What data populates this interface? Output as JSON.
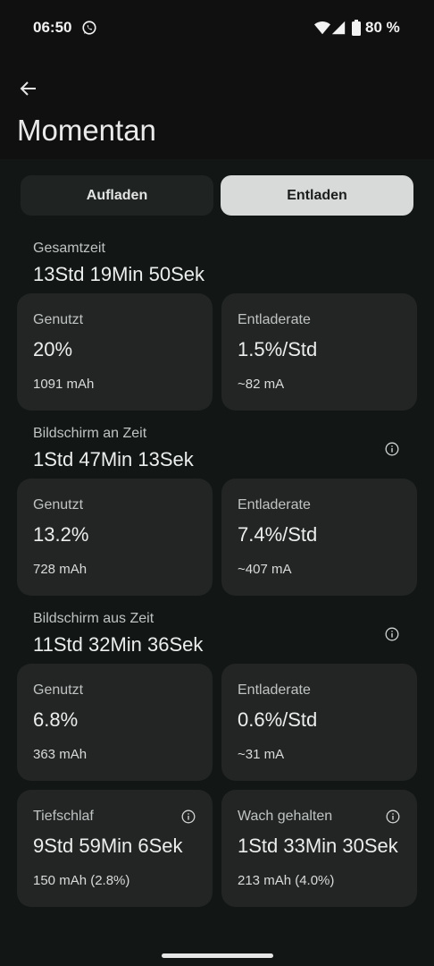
{
  "status": {
    "time": "06:50",
    "battery": "80 %"
  },
  "header": {
    "title": "Momentan"
  },
  "tabs": {
    "charge": "Aufladen",
    "discharge": "Entladen"
  },
  "total": {
    "label": "Gesamtzeit",
    "value": "13Std 19Min 50Sek",
    "used": {
      "label": "Genutzt",
      "value": "20%",
      "sub": "1091 mAh"
    },
    "rate": {
      "label": "Entladerate",
      "value": "1.5%/Std",
      "sub": "~82 mA"
    }
  },
  "screen_on": {
    "label": "Bildschirm an Zeit",
    "value": "1Std 47Min 13Sek",
    "used": {
      "label": "Genutzt",
      "value": "13.2%",
      "sub": "728 mAh"
    },
    "rate": {
      "label": "Entladerate",
      "value": "7.4%/Std",
      "sub": "~407 mA"
    }
  },
  "screen_off": {
    "label": "Bildschirm aus Zeit",
    "value": "11Std 32Min 36Sek",
    "used": {
      "label": "Genutzt",
      "value": "6.8%",
      "sub": "363 mAh"
    },
    "rate": {
      "label": "Entladerate",
      "value": "0.6%/Std",
      "sub": "~31 mA"
    }
  },
  "deep_sleep": {
    "label": "Tiefschlaf",
    "value": "9Std 59Min 6Sek",
    "sub": "150 mAh (2.8%)"
  },
  "awake": {
    "label": "Wach gehalten",
    "value": "1Std 33Min 30Sek",
    "sub": "213 mAh (4.0%)"
  }
}
